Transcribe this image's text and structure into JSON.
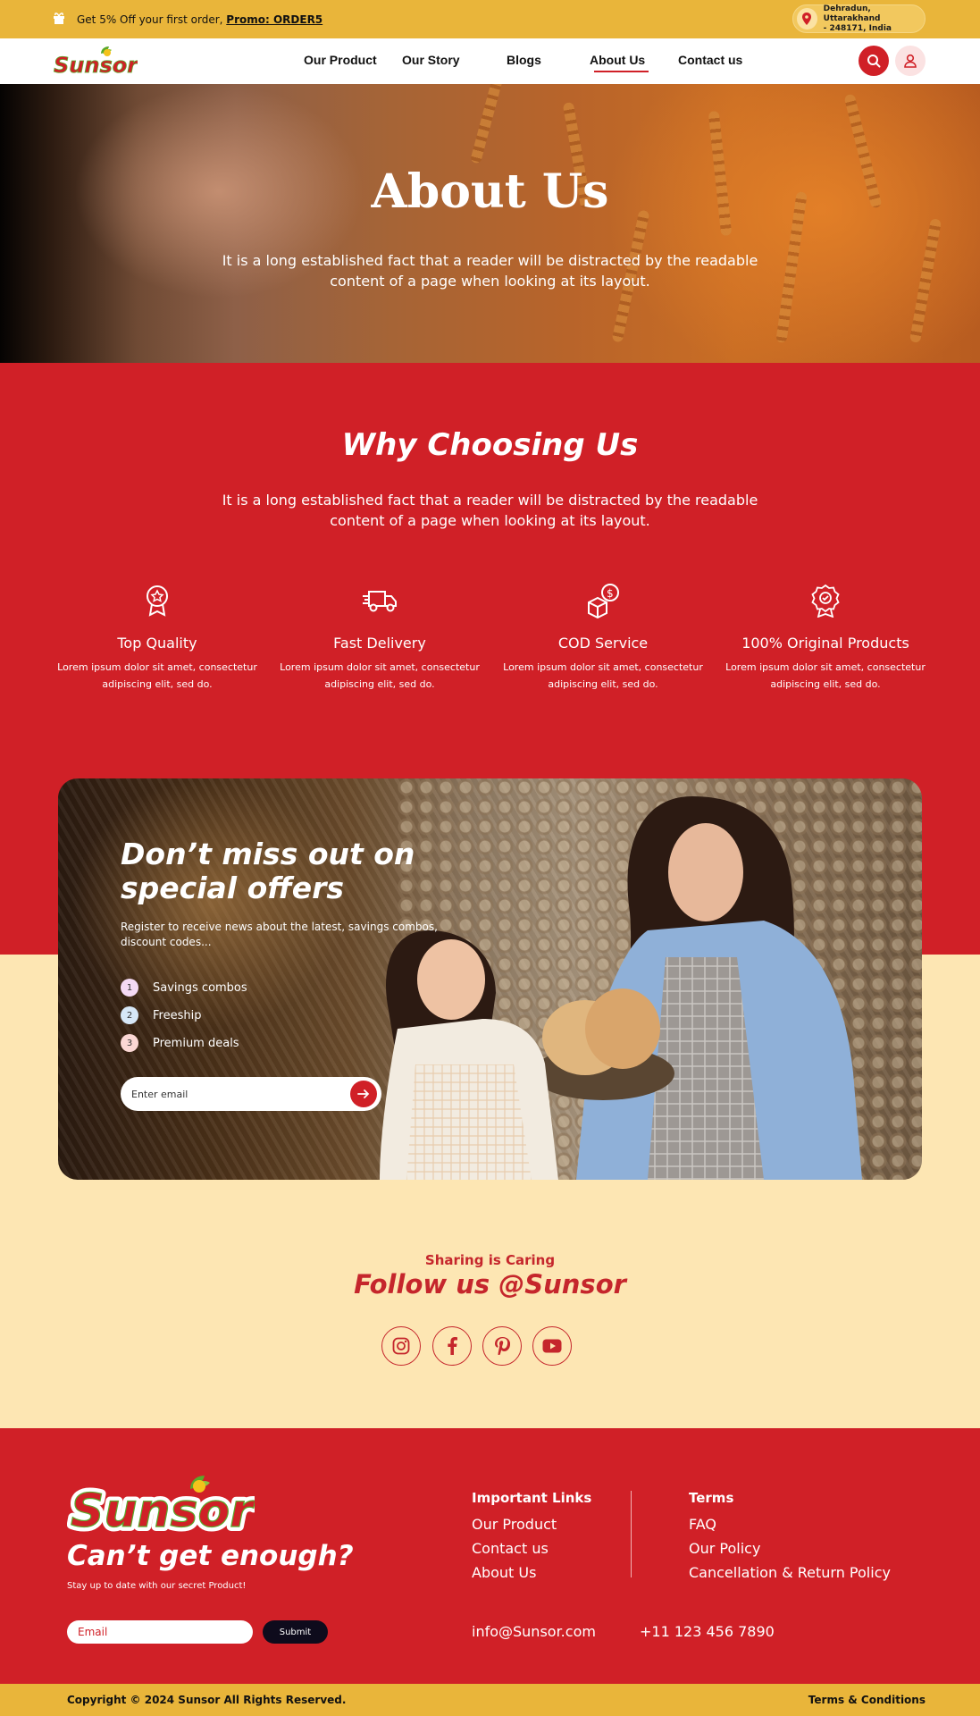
{
  "topbar": {
    "promo_text": "Get 5% Off your first order,",
    "promo_code": "Promo: ORDER5",
    "location_line1": "Dehradun, Uttarakhand",
    "location_line2": "- 248171, India"
  },
  "nav": {
    "logo": "Sunsor",
    "items": [
      "Our Product",
      "Our Story",
      "Blogs",
      "About Us",
      "Contact us"
    ],
    "active": "About Us"
  },
  "hero": {
    "title": "About Us",
    "text": "It is a long established fact that a reader will be distracted by the readable content of a page when looking at its layout."
  },
  "why": {
    "title": "Why Choosing Us",
    "text": "It is a long established fact that a reader will be distracted by the readable content of a page when looking at its layout.",
    "features": [
      {
        "icon": "award-icon",
        "title": "Top Quality",
        "desc": "Lorem ipsum dolor sit amet, consectetur adipiscing elit, sed do."
      },
      {
        "icon": "truck-icon",
        "title": "Fast Delivery",
        "desc": "Lorem ipsum dolor sit amet, consectetur adipiscing elit, sed do."
      },
      {
        "icon": "cod-box-icon",
        "title": "COD Service",
        "desc": "Lorem ipsum dolor sit amet, consectetur adipiscing elit, sed do."
      },
      {
        "icon": "original-badge-icon",
        "title": "100% Original Products",
        "desc": "Lorem ipsum dolor sit amet, consectetur adipiscing elit, sed do."
      }
    ]
  },
  "offer": {
    "title_line1": "Don’t miss out on",
    "title_line2": "special offers",
    "subtitle": "Register to receive news about the latest, savings combos, discount codes...",
    "list": [
      {
        "num": "1",
        "label": "Savings combos",
        "color": "#f4d9f4"
      },
      {
        "num": "2",
        "label": "Freeship",
        "color": "#d6e7f7"
      },
      {
        "num": "3",
        "label": "Premium deals",
        "color": "#fbd7d4"
      }
    ],
    "email_placeholder": "Enter email"
  },
  "follow": {
    "kicker": "Sharing is Caring",
    "title": "Follow us @Sunsor",
    "social": [
      "instagram-icon",
      "facebook-icon",
      "pinterest-icon",
      "youtube-icon"
    ]
  },
  "footer": {
    "logo": "Sunsor",
    "tagline": "Can’t get enough?",
    "small": "Stay up to date with our secret Product!",
    "email_placeholder": "Email",
    "submit": "Submit",
    "important_heading": "Important Links",
    "important_links": [
      "Our Product",
      "Contact us",
      "About Us"
    ],
    "terms_heading": "Terms",
    "terms_links": [
      "FAQ",
      "Our Policy",
      "Cancellation & Return Policy"
    ],
    "email": "info@Sunsor.com",
    "phone": "+11 123 456 7890",
    "copyright": "Copyright © 2024 Sunsor   All Rights Reserved.",
    "terms_conditions": "Terms & Conditions"
  },
  "colors": {
    "brand_red": "#d02027",
    "brand_yellow": "#e9b53a",
    "cream": "#fde6b3"
  }
}
